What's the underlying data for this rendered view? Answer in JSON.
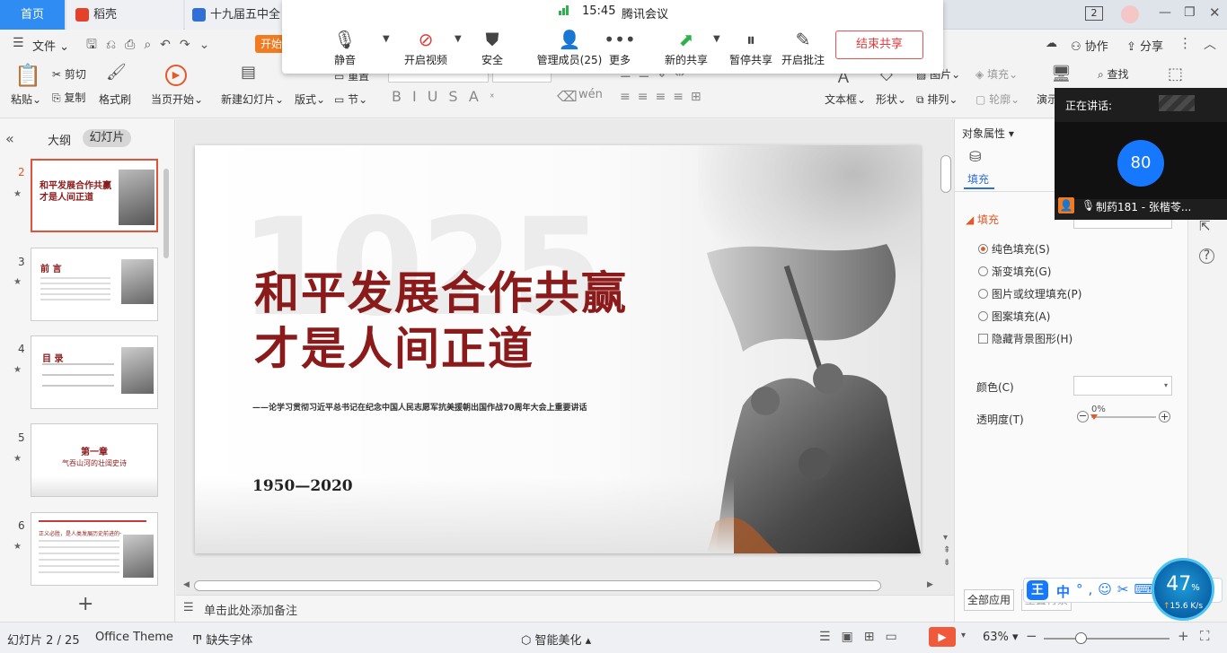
{
  "tabs": {
    "home": "首页",
    "daoke": "稻壳",
    "doc": "十九届五中全会"
  },
  "window": {
    "page_badge": "2"
  },
  "meeting": {
    "signal_time": "15:45",
    "app": "腾讯会议",
    "buttons": [
      "静音",
      "开启视频",
      "安全",
      "管理成员(25)",
      "更多",
      "新的共享",
      "暂停共享",
      "开启批注"
    ],
    "end_share": "结束共享"
  },
  "menu": {
    "file": "文件",
    "start": "开始",
    "collab": "协作",
    "share": "分享"
  },
  "ribbon": {
    "paste": "粘贴",
    "cut": "剪切",
    "copy": "复制",
    "format_painter": "格式刷",
    "from_current": "当页开始",
    "new_slide": "新建幻灯片",
    "layout": "版式",
    "reset": "重置",
    "section": "节",
    "textbox": "文本框",
    "shape": "形状",
    "image": "图片",
    "arrange": "排列",
    "fill": "填充",
    "outline": "轮廓",
    "find": "查找",
    "present": "演示"
  },
  "left": {
    "outline": "大纲",
    "slides": "幻灯片",
    "thumbs": [
      {
        "num": "2",
        "title": "和平发展合作共赢才是人间正道"
      },
      {
        "num": "3",
        "title": "前 言"
      },
      {
        "num": "4",
        "title": "目 录"
      },
      {
        "num": "5",
        "title": "第一章",
        "subtitle": "气吞山河的壮阔史诗"
      },
      {
        "num": "6",
        "title": "正义必胜，是人类发展历史前进的一个真理"
      }
    ]
  },
  "slide": {
    "title_line1": "和平发展合作共赢",
    "title_line2": "才是人间正道",
    "subtitle": "——论学习贯彻习近平总书记在纪念中国人民志愿军抗美援朝出国作战70周年大会上重要讲话",
    "years": "1950—2020"
  },
  "notes": {
    "placeholder": "单击此处添加备注"
  },
  "properties": {
    "header": "对象属性",
    "tab_fill": "填充",
    "section": "填充",
    "options": [
      "纯色填充(S)",
      "渐变填充(G)",
      "图片或纹理填充(P)",
      "图案填充(A)"
    ],
    "hide_bg": "隐藏背景图形(H)",
    "color_label": "颜色(C)",
    "transparency_label": "透明度(T)",
    "transparency_value": "0%",
    "apply_all": "全部应用",
    "reset_bg": "重置背景"
  },
  "speaker": {
    "label": "正在讲话:",
    "badge": "80",
    "name": "制药181 - 张楷苓..."
  },
  "status": {
    "slide_count": "幻灯片 2 / 25",
    "theme": "Office Theme",
    "missing_font": "缺失字体",
    "beautify": "智能美化",
    "zoom": "63%"
  },
  "netspeed": {
    "percent": "47",
    "unit": "%",
    "rate": "15.6 K/s"
  },
  "ime": {
    "brand": "王",
    "lang": "中"
  },
  "colors": {
    "accent": "#2f8cf3",
    "slide_title": "#8b1a1a",
    "orange": "#f07b20",
    "close_red": "#e03c3c"
  }
}
